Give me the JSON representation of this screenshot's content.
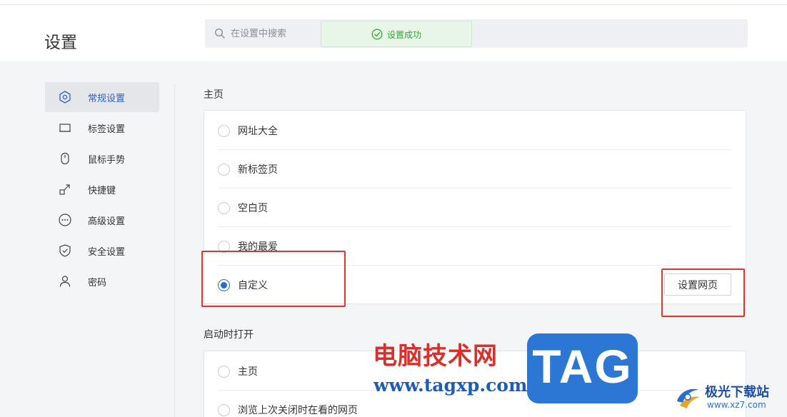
{
  "header": {
    "title": "设置",
    "search": {
      "placeholder": "在设置中搜索",
      "icon": "search-icon"
    },
    "toast": {
      "text": "设置成功",
      "icon": "check-circle-icon",
      "color": "#33a53a"
    }
  },
  "sidebar": {
    "items": [
      {
        "label": "常规设置",
        "icon": "general-settings-icon",
        "active": true
      },
      {
        "label": "标签设置",
        "icon": "tab-icon",
        "active": false
      },
      {
        "label": "鼠标手势",
        "icon": "mouse-icon",
        "active": false
      },
      {
        "label": "快捷键",
        "icon": "shortcut-icon",
        "active": false
      },
      {
        "label": "高级设置",
        "icon": "more-icon",
        "active": false
      },
      {
        "label": "安全设置",
        "icon": "shield-icon",
        "active": false
      },
      {
        "label": "密码",
        "icon": "user-icon",
        "active": false
      }
    ]
  },
  "homepage": {
    "title": "主页",
    "options": [
      {
        "label": "网址大全",
        "checked": false
      },
      {
        "label": "新标签页",
        "checked": false
      },
      {
        "label": "空白页",
        "checked": false
      },
      {
        "label": "我的最爱",
        "checked": false
      },
      {
        "label": "自定义",
        "checked": true
      }
    ],
    "set_page_button": "设置网页"
  },
  "startup": {
    "title": "启动时打开",
    "options": [
      {
        "label": "主页",
        "checked": false
      },
      {
        "label": "浏览上次关闭时在看的网页",
        "checked": false
      }
    ]
  },
  "watermark": {
    "site_name": "电脑技术网",
    "site_url": "www.tagxp.com",
    "tag": "TAG",
    "logo_name": "极光下载站",
    "logo_url": "www.xz7.com"
  },
  "colors": {
    "accent": "#2a6bd6",
    "highlight_box": "#e0332f",
    "toast_bg": "#e7f6e6"
  }
}
